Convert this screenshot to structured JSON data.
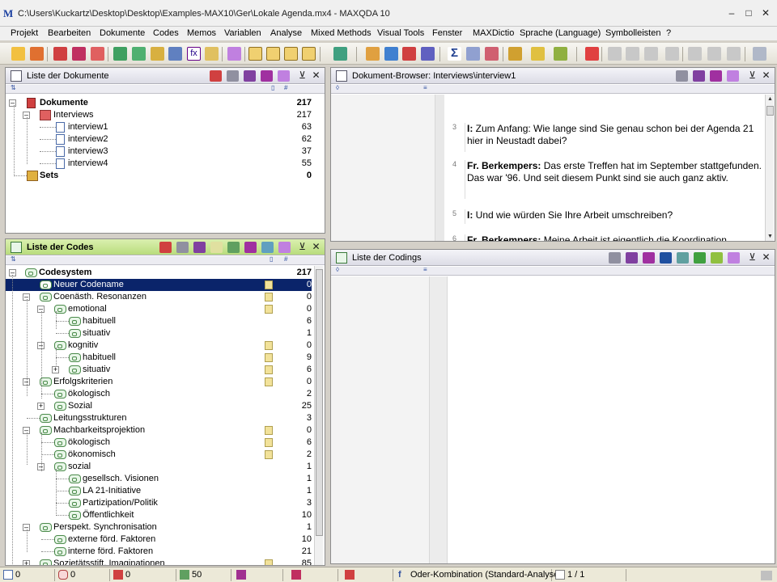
{
  "window": {
    "title": "C:\\Users\\Kuckartz\\Desktop\\Desktop\\Examples-MAX10\\Ger\\Lokale Agenda.mx4 - MAXQDA 10",
    "logo_letter": "M"
  },
  "menu": [
    "Projekt",
    "Bearbeiten",
    "Dokumente",
    "Codes",
    "Memos",
    "Variablen",
    "Analyse",
    "Mixed Methods",
    "Visual Tools",
    "Fenster",
    "MAXDictio",
    "Sprache (Language)",
    "Symbolleisten",
    "?"
  ],
  "doc_list": {
    "title": "Liste der Dokumente",
    "rows": [
      {
        "label": "Dokumente",
        "count": "217"
      },
      {
        "label": "Interviews",
        "count": "217"
      },
      {
        "label": "interview1",
        "count": "63"
      },
      {
        "label": "interview2",
        "count": "62"
      },
      {
        "label": "interview3",
        "count": "37"
      },
      {
        "label": "interview4",
        "count": "55"
      },
      {
        "label": "Sets",
        "count": "0"
      }
    ]
  },
  "doc_browser": {
    "title": "Dokument-Browser: Interviews\\interview1",
    "paragraphs": [
      {
        "num": "3",
        "speaker": "I:",
        "text": " Zum Anfang: Wie lange sind Sie genau schon bei der Agenda 21 hier in Neustadt dabei?"
      },
      {
        "num": "4",
        "speaker": "Fr. Berkempers:",
        "text": " Das erste Treffen hat im September stattgefunden. Das war '96. Und seit diesem Punkt sind sie auch ganz aktiv."
      },
      {
        "num": "5",
        "speaker": "I:",
        "text": " Und wie würden Sie Ihre Arbeit umschreiben?"
      },
      {
        "num": "6",
        "speaker": "Fr. Berkempers:",
        "text": " Meine Arbeit ist eigentlich die Koordination"
      }
    ]
  },
  "code_list": {
    "title": "Liste der Codes",
    "rows": [
      {
        "label": "Codesystem",
        "count": "217"
      },
      {
        "label": "Neuer Codename",
        "count": "0"
      },
      {
        "label": "Coenästh. Resonanzen",
        "count": "0"
      },
      {
        "label": "emotional",
        "count": "0"
      },
      {
        "label": "habituell",
        "count": "6"
      },
      {
        "label": "situativ",
        "count": "1"
      },
      {
        "label": "kognitiv",
        "count": "0"
      },
      {
        "label": "habituell",
        "count": "9"
      },
      {
        "label": "situativ",
        "count": "6"
      },
      {
        "label": "Erfolgskriterien",
        "count": "0"
      },
      {
        "label": "ökologisch",
        "count": "2"
      },
      {
        "label": "Sozial",
        "count": "25"
      },
      {
        "label": "Leitungsstrukturen",
        "count": "3"
      },
      {
        "label": "Machbarkeitsprojektion",
        "count": "0"
      },
      {
        "label": "ökologisch",
        "count": "6"
      },
      {
        "label": "ökonomisch",
        "count": "2"
      },
      {
        "label": "sozial",
        "count": "1"
      },
      {
        "label": "gesellsch. Visionen",
        "count": "1"
      },
      {
        "label": "LA 21-Initiative",
        "count": "1"
      },
      {
        "label": "Partizipation/Politik",
        "count": "3"
      },
      {
        "label": "Öffentlichkeit",
        "count": "10"
      },
      {
        "label": "Perspekt. Synchronisation",
        "count": "1"
      },
      {
        "label": "externe förd. Faktoren",
        "count": "10"
      },
      {
        "label": "interne förd. Faktoren",
        "count": "21"
      },
      {
        "label": "Sozietätsstift. Imaginationen",
        "count": "85"
      }
    ]
  },
  "codings_list": {
    "title": "Liste der Codings"
  },
  "statusbar": {
    "docs": "0",
    "codes": "0",
    "memos": "0",
    "vars": "50",
    "combo": "Oder-Kombination (Standard-Analyse)",
    "page": "1 / 1"
  }
}
